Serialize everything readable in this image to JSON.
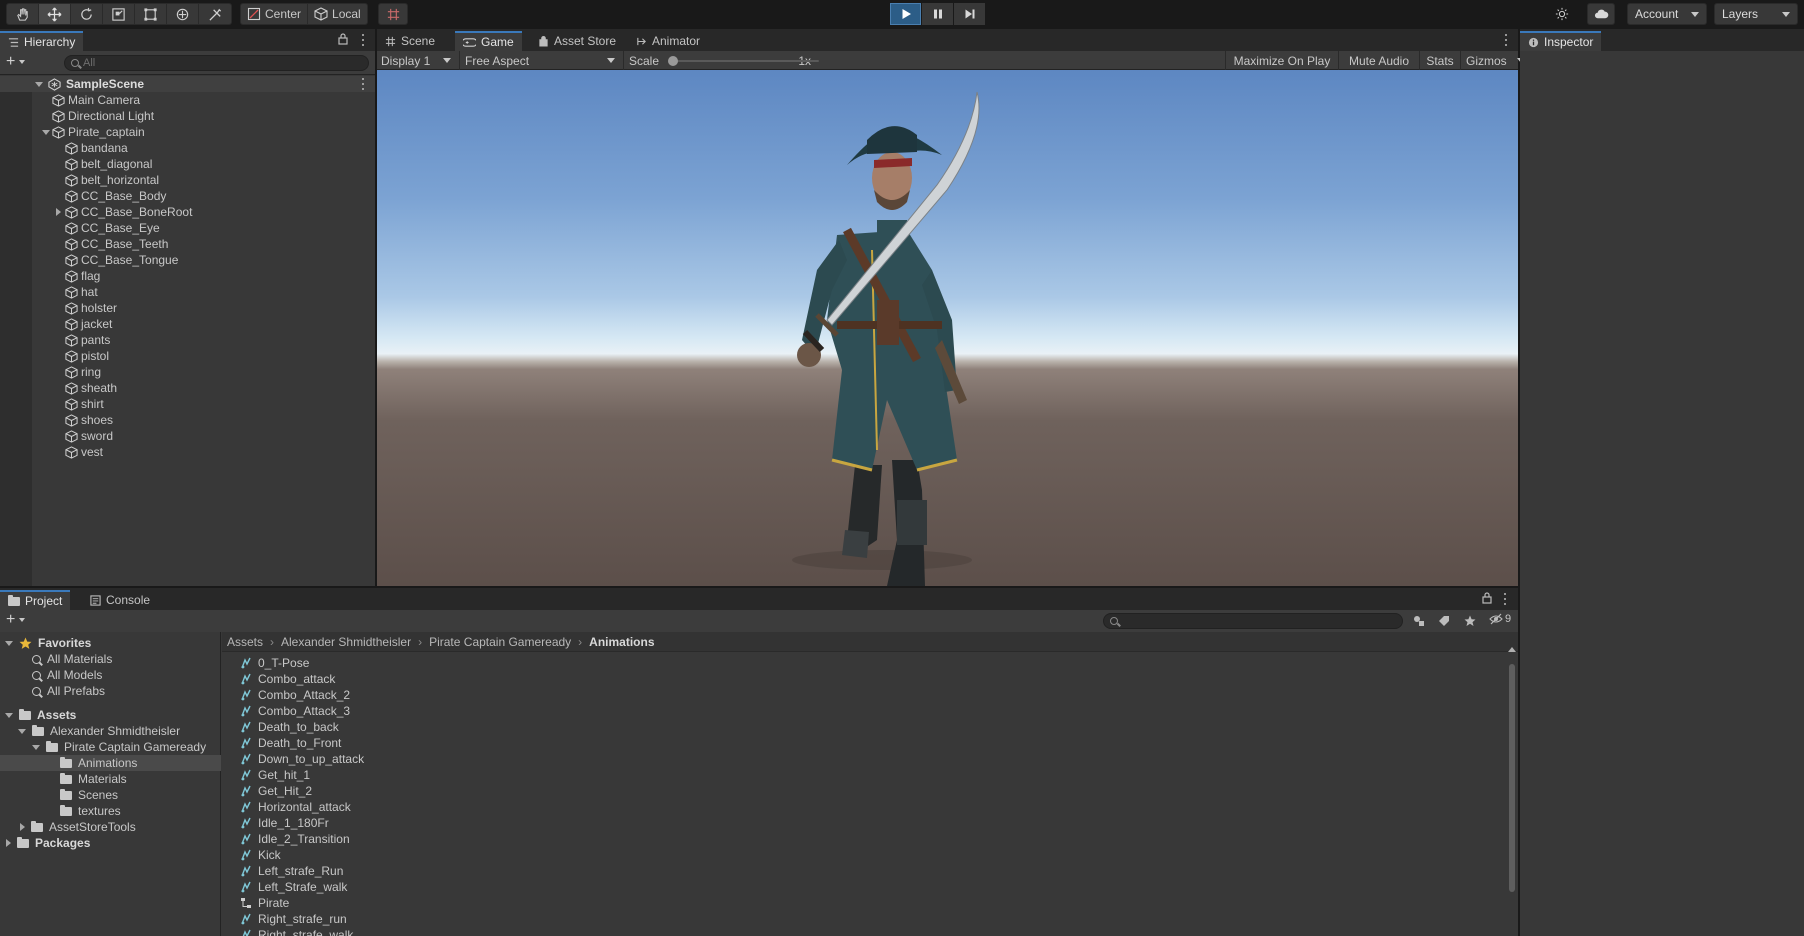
{
  "toolbar": {
    "pivot_center": "Center",
    "pivot_local": "Local",
    "account": "Account",
    "layers": "Layers"
  },
  "hierarchy": {
    "tab": "Hierarchy",
    "search_placeholder": "All",
    "scene": "SampleScene",
    "items": [
      "Main Camera",
      "Directional Light",
      "Pirate_captain",
      "bandana",
      "belt_diagonal",
      "belt_horizontal",
      "CC_Base_Body",
      "CC_Base_BoneRoot",
      "CC_Base_Eye",
      "CC_Base_Teeth",
      "CC_Base_Tongue",
      "flag",
      "hat",
      "holster",
      "jacket",
      "pants",
      "pistol",
      "ring",
      "sheath",
      "shirt",
      "shoes",
      "sword",
      "vest"
    ]
  },
  "center_tabs": {
    "scene": "Scene",
    "game": "Game",
    "asset_store": "Asset Store",
    "animator": "Animator"
  },
  "game": {
    "display": "Display 1",
    "aspect": "Free Aspect",
    "scale_label": "Scale",
    "scale_value": "1x",
    "maximize": "Maximize On Play",
    "mute": "Mute Audio",
    "stats": "Stats",
    "gizmos": "Gizmos"
  },
  "inspector": {
    "tab": "Inspector"
  },
  "project": {
    "tab_project": "Project",
    "tab_console": "Console",
    "hidden_count": "9",
    "favorites": {
      "label": "Favorites",
      "items": [
        "All Materials",
        "All Models",
        "All Prefabs"
      ]
    },
    "assets": {
      "label": "Assets",
      "author": "Alexander Shmidtheisler",
      "pack": "Pirate Captain Gameready",
      "folders": [
        "Animations",
        "Materials",
        "Scenes",
        "textures"
      ],
      "asset_store_tools": "AssetStoreTools"
    },
    "packages": "Packages",
    "breadcrumb": [
      "Assets",
      "Alexander Shmidtheisler",
      "Pirate Captain Gameready",
      "Animations"
    ],
    "files": [
      "0_T-Pose",
      "Combo_attack",
      "Combo_Attack_2",
      "Combo_Attack_3",
      "Death_to_back",
      "Death_to_Front",
      "Down_to_up_attack",
      "Get_hit_1",
      "Get_Hit_2",
      "Horizontal_attack",
      "Idle_1_180Fr",
      "Idle_2_Transition",
      "Kick",
      "Left_strafe_Run",
      "Left_Strafe_walk",
      "Pirate",
      "Right_strafe_run",
      "Right_strafe_walk"
    ]
  }
}
